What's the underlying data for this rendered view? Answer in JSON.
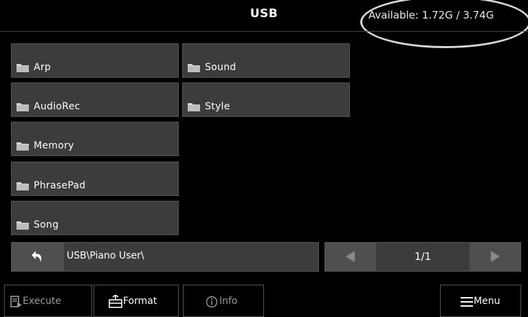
{
  "header": {
    "title": "USB",
    "storage": "Available: 1.72G / 3.74G"
  },
  "folders": [
    {
      "label": "Arp",
      "icon": "folder-icon"
    },
    {
      "label": "AudioRec",
      "icon": "folder-icon"
    },
    {
      "label": "Memory",
      "icon": "folder-icon"
    },
    {
      "label": "PhrasePad",
      "icon": "folder-icon"
    },
    {
      "label": "Song",
      "icon": "folder-icon"
    },
    {
      "label": "Sound",
      "icon": "folder-icon"
    },
    {
      "label": "Style",
      "icon": "folder-icon"
    }
  ],
  "path": {
    "current": "USB\\Piano User\\",
    "back_icon": "back-arrow-icon"
  },
  "pager": {
    "page": "1/1",
    "prev_icon": "triangle-left-icon",
    "next_icon": "triangle-right-icon"
  },
  "toolbar": {
    "execute_label": "Execute",
    "format_label": "Format",
    "info_label": "Info",
    "menu_label": "Menu"
  },
  "colors": {
    "background": "#000000",
    "panel": "#3c3c3c",
    "button": "#4f4f4f",
    "disabled_text": "#9a9a9a"
  }
}
